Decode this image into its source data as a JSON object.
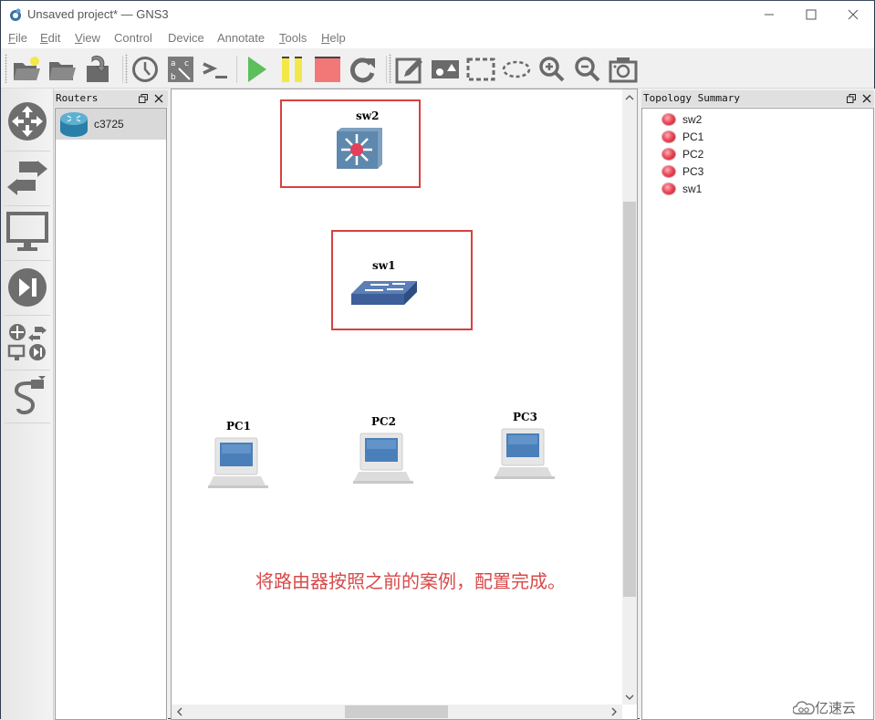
{
  "window": {
    "title": "Unsaved project* — GNS3",
    "controls": [
      "minimize",
      "maximize",
      "close"
    ]
  },
  "menu": {
    "items": [
      {
        "label": "File",
        "mnemonic": "F"
      },
      {
        "label": "Edit",
        "mnemonic": "E"
      },
      {
        "label": "View",
        "mnemonic": "V"
      },
      {
        "label": "Control",
        "mnemonic": ""
      },
      {
        "label": "Device",
        "mnemonic": ""
      },
      {
        "label": "Annotate",
        "mnemonic": ""
      },
      {
        "label": "Tools",
        "mnemonic": "T"
      },
      {
        "label": "Help",
        "mnemonic": "H"
      }
    ]
  },
  "toolbar": {
    "buttons": [
      "new-project-icon",
      "open-project-icon",
      "save-project-icon",
      "snapshot-clock-icon",
      "show-interface-labels-icon",
      "console-all-icon",
      "start-all-icon",
      "suspend-all-icon",
      "stop-all-icon",
      "reload-all-icon",
      "add-note-icon",
      "insert-image-icon",
      "draw-rectangle-icon",
      "draw-ellipse-icon",
      "zoom-in-icon",
      "zoom-out-icon",
      "screenshot-icon"
    ],
    "colors": {
      "start": "#5cbf5c",
      "suspend": "#f2e84a",
      "stop": "#f27878",
      "icon": "#6a6a6a"
    }
  },
  "left_dock": {
    "buttons": [
      "routers",
      "switches",
      "end-devices",
      "security-devices",
      "all-devices",
      "add-link"
    ]
  },
  "routers_panel": {
    "title": "Routers",
    "items": [
      {
        "label": "c3725"
      }
    ]
  },
  "canvas": {
    "nodes": [
      {
        "name": "sw2",
        "type": "multilayer-switch"
      },
      {
        "name": "sw1",
        "type": "ethernet-switch"
      },
      {
        "name": "PC1",
        "type": "vpcs"
      },
      {
        "name": "PC2",
        "type": "vpcs"
      },
      {
        "name": "PC3",
        "type": "vpcs"
      }
    ],
    "annotation_text": "将路由器按照之前的案例，配置完成。",
    "annotation_color": "#d84a4a",
    "rect_color": "#d84040",
    "vscroll_position": 0.18,
    "hscroll_position": 0.38
  },
  "topology_summary": {
    "title": "Topology Summary",
    "items": [
      {
        "label": "sw2",
        "status": "stopped"
      },
      {
        "label": "PC1",
        "status": "stopped"
      },
      {
        "label": "PC2",
        "status": "stopped"
      },
      {
        "label": "PC3",
        "status": "stopped"
      },
      {
        "label": "sw1",
        "status": "stopped"
      }
    ]
  },
  "watermark": {
    "text": "亿速云"
  }
}
